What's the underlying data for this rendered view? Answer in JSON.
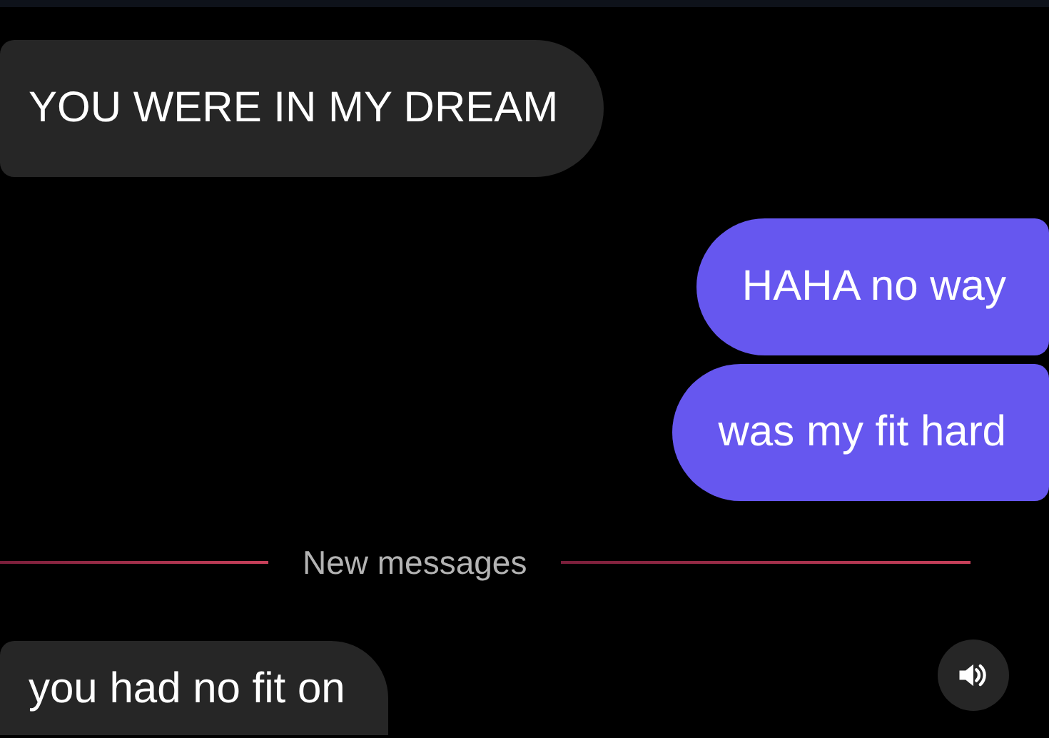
{
  "messages": [
    {
      "kind": "received",
      "text": "YOU WERE IN MY DREAM"
    },
    {
      "kind": "sent",
      "text": "HAHA no way"
    },
    {
      "kind": "sent",
      "text": "was my fit hard"
    }
  ],
  "divider": {
    "label": "New messages"
  },
  "new_messages": [
    {
      "kind": "received",
      "text": "you had no fit on"
    }
  ],
  "sound_button": {
    "muted": false
  }
}
